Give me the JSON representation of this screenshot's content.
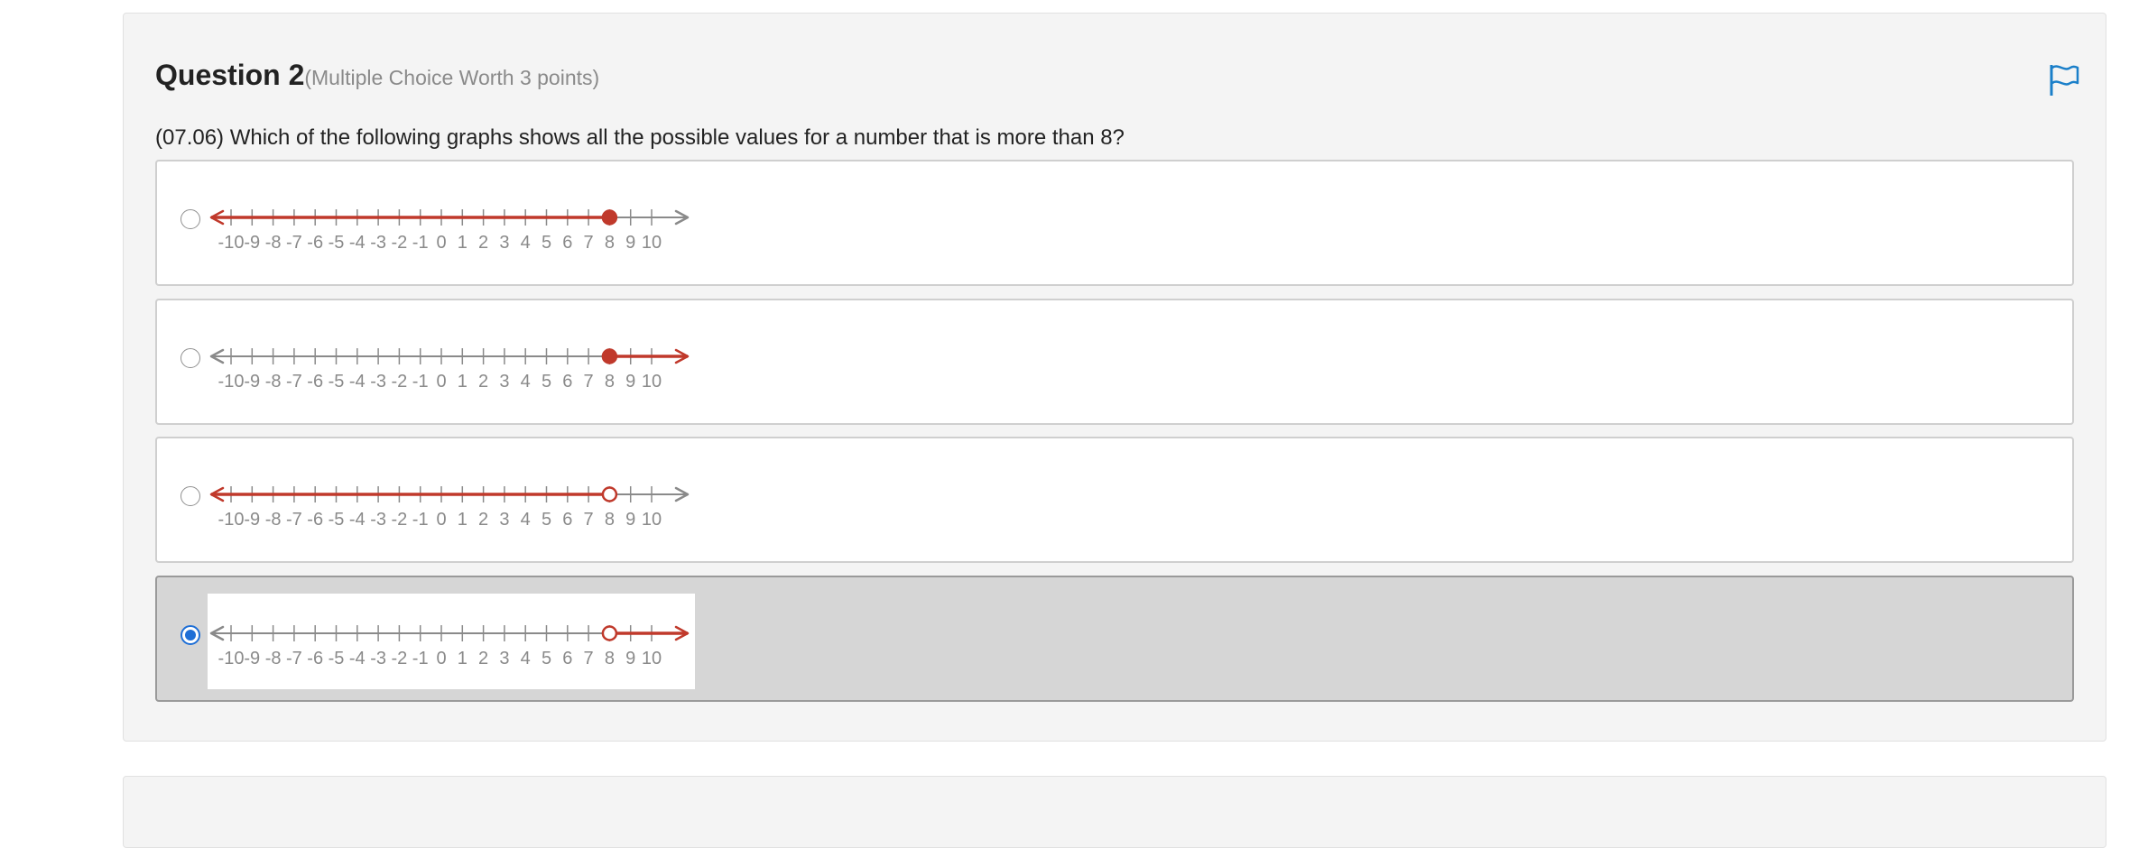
{
  "question": {
    "title": "Question 2",
    "worth": "(Multiple Choice Worth 3 points)",
    "text": "(07.06) Which of the following graphs shows all the possible values for a number that is more than 8?"
  },
  "flag_icon": "flag-icon",
  "colors": {
    "accent": "#1f6fd6",
    "shade": "#c0392b",
    "axis": "#8a8a8a",
    "flag": "#1a7fc9"
  },
  "number_line": {
    "min": -10,
    "max": 10,
    "tick_labels": [
      "-10",
      "-9",
      "-8",
      "-7",
      "-6",
      "-5",
      "-4",
      "-3",
      "-2",
      "-1",
      "0",
      "1",
      "2",
      "3",
      "4",
      "5",
      "6",
      "7",
      "8",
      "9",
      "10"
    ]
  },
  "choices": [
    {
      "point": 8,
      "closed": true,
      "direction": "left",
      "selected": false
    },
    {
      "point": 8,
      "closed": true,
      "direction": "right",
      "selected": false
    },
    {
      "point": 8,
      "closed": false,
      "direction": "left",
      "selected": false
    },
    {
      "point": 8,
      "closed": false,
      "direction": "right",
      "selected": true
    }
  ]
}
